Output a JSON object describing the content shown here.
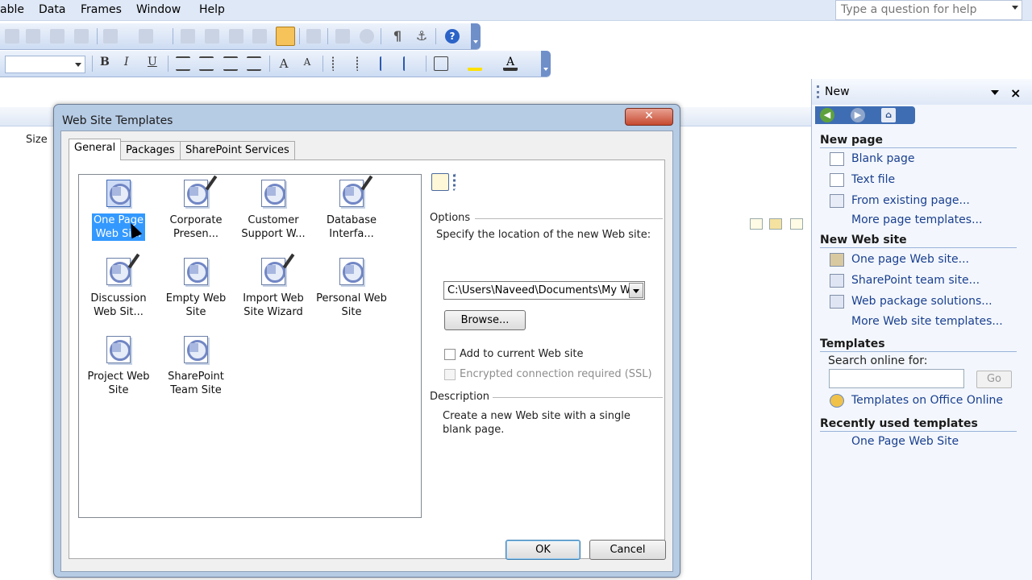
{
  "menu": {
    "items": [
      "able",
      "Data",
      "Frames",
      "Window",
      "Help"
    ],
    "help_placeholder": "Type a question for help"
  },
  "background": {
    "column_size": "Size"
  },
  "formatting": {
    "bold": "B",
    "italic": "I",
    "underline": "U"
  },
  "task_pane": {
    "title": "New",
    "close": "×",
    "sections": {
      "new_page": "New page",
      "new_web_site": "New Web site",
      "templates": "Templates",
      "recent": "Recently used templates"
    },
    "new_page_links": [
      "Blank page",
      "Text file",
      "From existing page...",
      "More page templates..."
    ],
    "new_site_links": [
      "One page Web site...",
      "SharePoint team site...",
      "Web package solutions...",
      "More Web site templates..."
    ],
    "search_label": "Search online for:",
    "go": "Go",
    "online_link": "Templates on Office Online",
    "recent_link": "One Page Web Site"
  },
  "dialog": {
    "title": "Web Site Templates",
    "close": "✕",
    "tabs": [
      "General",
      "Packages",
      "SharePoint Services"
    ],
    "templates": [
      {
        "line1": "One Page",
        "line2": "Web Si...",
        "selected": true
      },
      {
        "line1": "Corporate",
        "line2": "Presen..."
      },
      {
        "line1": "Customer",
        "line2": "Support W..."
      },
      {
        "line1": "Database",
        "line2": "Interfa..."
      },
      {
        "line1": "Discussion",
        "line2": "Web Sit..."
      },
      {
        "line1": "Empty Web",
        "line2": "Site"
      },
      {
        "line1": "Import Web",
        "line2": "Site Wizard"
      },
      {
        "line1": "Personal Web",
        "line2": "Site"
      },
      {
        "line1": "Project Web",
        "line2": "Site"
      },
      {
        "line1": "SharePoint",
        "line2": "Team Site"
      }
    ],
    "options_title": "Options",
    "location_label": "Specify the location of the new Web site:",
    "location_value": "C:\\Users\\Naveed\\Documents\\My We",
    "browse": "Browse...",
    "add_current": "Add to current Web site",
    "ssl": "Encrypted connection required (SSL)",
    "description_title": "Description",
    "description": "Create a new Web site with a single blank page.",
    "ok": "OK",
    "cancel": "Cancel"
  }
}
